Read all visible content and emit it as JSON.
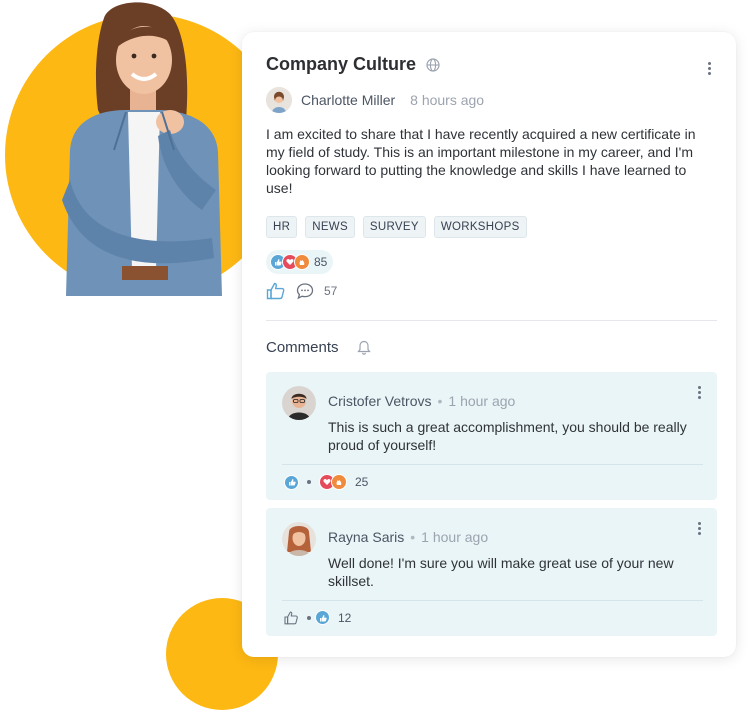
{
  "post": {
    "title": "Company Culture",
    "author": "Charlotte Miller",
    "time": "8 hours ago",
    "body": "I am excited to share that I have recently acquired a new certificate in my field of study. This is an important milestone in my career, and I'm looking forward to putting the knowledge and skills I have learned to use!",
    "tags": [
      "HR",
      "NEWS",
      "SURVEY",
      "WORKSHOPS"
    ],
    "reactions_count": "85",
    "comments_count": "57"
  },
  "comments_section": {
    "title": "Comments"
  },
  "comments": [
    {
      "author": "Cristofer Vetrovs",
      "time": "1 hour ago",
      "text": "This is such a great accomplishment, you should be really proud of yourself!",
      "reactions_count": "25"
    },
    {
      "author": "Rayna Saris",
      "time": "1 hour ago",
      "text": "Well done! I'm sure you will make great use of your new skillset.",
      "reactions_count": "12"
    }
  ],
  "colors": {
    "accent_yellow": "#FDB813",
    "comment_bg": "#eaf5f8",
    "like_blue": "#5aa6d6"
  }
}
